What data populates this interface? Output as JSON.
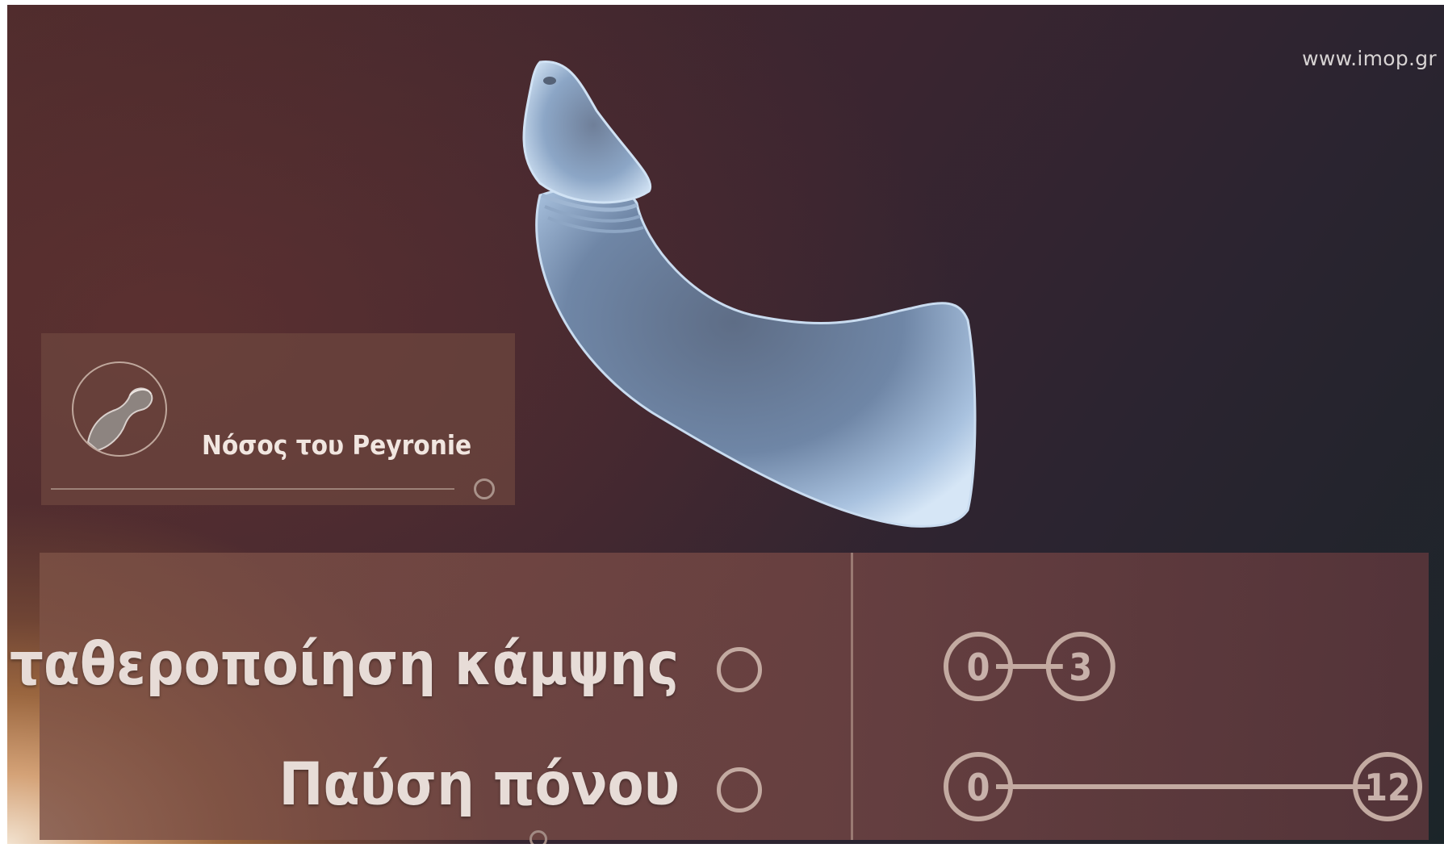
{
  "watermark": "www.imop.gr",
  "topic": {
    "title": "Νόσος του Peyronie",
    "icon": "curved-penis-icon"
  },
  "results": [
    {
      "label": "Σταθεροποίηση κάμψης",
      "start": "0",
      "end": "3",
      "span_fraction": 0.25
    },
    {
      "label": "Παύση πόνου",
      "start": "0",
      "end": "12",
      "span_fraction": 1.0
    }
  ],
  "colors": {
    "panel": "#7d5246",
    "text": "#e7dcd7",
    "organ": "#a7c0dc"
  }
}
